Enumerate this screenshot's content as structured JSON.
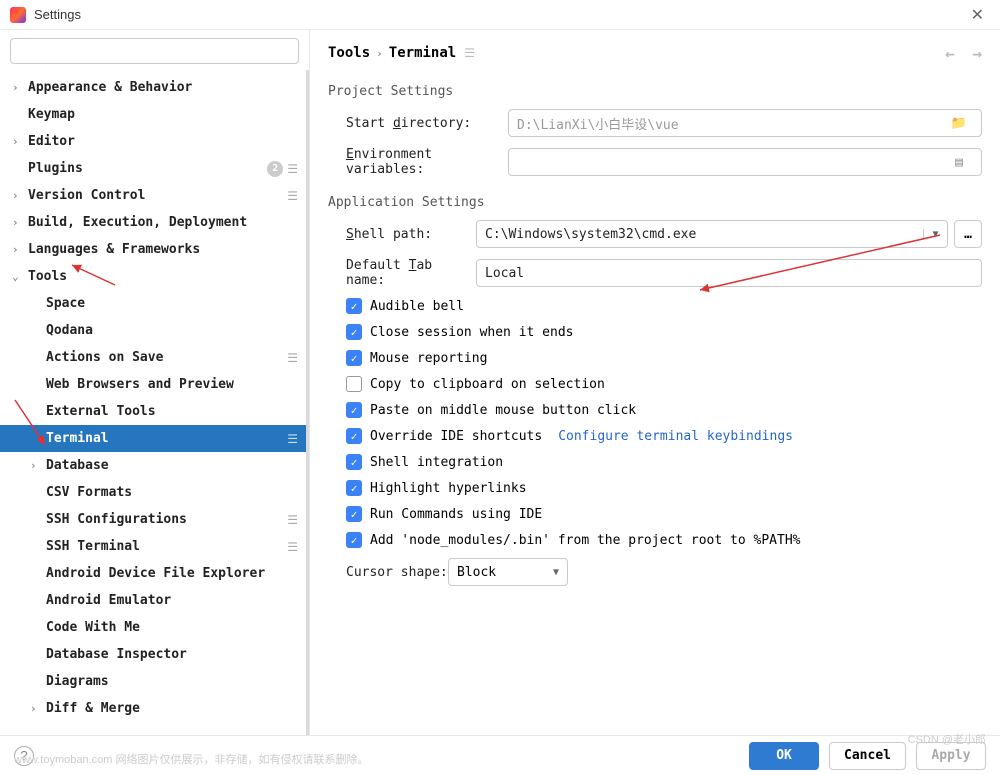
{
  "window": {
    "title": "Settings"
  },
  "search": {
    "placeholder": ""
  },
  "tree": [
    {
      "label": "Appearance & Behavior",
      "arrow": "›",
      "depth": 0
    },
    {
      "label": "Keymap",
      "arrow": "",
      "depth": 0
    },
    {
      "label": "Editor",
      "arrow": "›",
      "depth": 0
    },
    {
      "label": "Plugins",
      "arrow": "",
      "depth": 0,
      "badge": "2",
      "scope": "☰"
    },
    {
      "label": "Version Control",
      "arrow": "›",
      "depth": 0,
      "scope": "☰"
    },
    {
      "label": "Build, Execution, Deployment",
      "arrow": "›",
      "depth": 0
    },
    {
      "label": "Languages & Frameworks",
      "arrow": "›",
      "depth": 0
    },
    {
      "label": "Tools",
      "arrow": "⌄",
      "depth": 0
    },
    {
      "label": "Space",
      "arrow": "",
      "depth": 1
    },
    {
      "label": "Qodana",
      "arrow": "",
      "depth": 1
    },
    {
      "label": "Actions on Save",
      "arrow": "",
      "depth": 1,
      "scope": "☰"
    },
    {
      "label": "Web Browsers and Preview",
      "arrow": "",
      "depth": 1
    },
    {
      "label": "External Tools",
      "arrow": "",
      "depth": 1
    },
    {
      "label": "Terminal",
      "arrow": "",
      "depth": 1,
      "selected": true,
      "scope": "☰"
    },
    {
      "label": "Database",
      "arrow": "›",
      "depth": 1
    },
    {
      "label": "CSV Formats",
      "arrow": "",
      "depth": 1
    },
    {
      "label": "SSH Configurations",
      "arrow": "",
      "depth": 1,
      "scope": "☰"
    },
    {
      "label": "SSH Terminal",
      "arrow": "",
      "depth": 1,
      "scope": "☰"
    },
    {
      "label": "Android Device File Explorer",
      "arrow": "",
      "depth": 1
    },
    {
      "label": "Android Emulator",
      "arrow": "",
      "depth": 1
    },
    {
      "label": "Code With Me",
      "arrow": "",
      "depth": 1
    },
    {
      "label": "Database Inspector",
      "arrow": "",
      "depth": 1
    },
    {
      "label": "Diagrams",
      "arrow": "",
      "depth": 1
    },
    {
      "label": "Diff & Merge",
      "arrow": "›",
      "depth": 1
    }
  ],
  "breadcrumb": {
    "root": "Tools",
    "leaf": "Terminal"
  },
  "sections": {
    "project_h": "Project Settings",
    "app_h": "Application Settings"
  },
  "labels": {
    "start_dir_pre": "Start ",
    "start_dir_ul": "d",
    "start_dir_post": "irectory:",
    "env_ul": "E",
    "env_post": "nvironment variables:",
    "shell_ul": "S",
    "shell_post": "hell path:",
    "tab_pre": "Default ",
    "tab_ul": "T",
    "tab_post": "ab name:",
    "cursor": "Cursor shape:"
  },
  "values": {
    "start_dir": "D:\\LianXi\\小白毕设\\vue",
    "env": "",
    "shell": "C:\\Windows\\system32\\cmd.exe",
    "tab": "Local",
    "cursor": "Block"
  },
  "checks": [
    {
      "label": "Audible bell",
      "checked": true
    },
    {
      "label": "Close session when it ends",
      "checked": true
    },
    {
      "label": "Mouse reporting",
      "checked": true
    },
    {
      "label": "Copy to clipboard on selection",
      "checked": false
    },
    {
      "label": "Paste on middle mouse button click",
      "checked": true
    },
    {
      "label": "Override IDE shortcuts",
      "checked": true,
      "link": "Configure terminal keybindings"
    },
    {
      "label": "Shell integration",
      "checked": true
    },
    {
      "label": "Highlight hyperlinks",
      "checked": true
    },
    {
      "label": "Run Commands using IDE",
      "checked": true
    },
    {
      "label": "Add 'node_modules/.bin' from the project root to %PATH%",
      "checked": true
    }
  ],
  "buttons": {
    "ok": "OK",
    "cancel": "Cancel",
    "apply": "Apply"
  },
  "watermark": "www.toymoban.com  网络图片仅供展示，非存储，如有侵权请联系删除。",
  "watermark2": "CSDN @老小郎"
}
